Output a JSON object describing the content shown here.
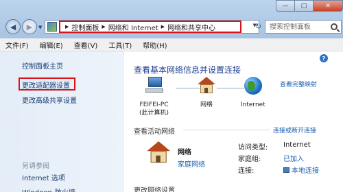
{
  "window": {
    "controls": {
      "minimize": "—",
      "maximize": "□",
      "close": "✕"
    }
  },
  "nav": {
    "back_glyph": "◀",
    "forward_glyph": "▶",
    "history_glyph": "▼",
    "refresh_glyph": "↻"
  },
  "address": {
    "breadcrumbs": [
      "控制面板",
      "网络和 Internet",
      "网络和共享中心"
    ],
    "separator": "▶",
    "dropdown_glyph": "▼"
  },
  "search": {
    "placeholder": "搜索控制面板"
  },
  "menu": [
    "文件(F)",
    "编辑(E)",
    "查看(V)",
    "工具(T)",
    "帮助(H)"
  ],
  "sidebar": {
    "home": "控制面板主页",
    "adapter_settings": "更改适配器设置",
    "advanced_sharing": "更改高级共享设置",
    "see_also": "另请参阅",
    "internet_options": "Internet 选项",
    "firewall": "Windows 防火墙"
  },
  "main": {
    "help": "?",
    "title": "查看基本网络信息并设置连接",
    "see_full_map": "查看完整映射",
    "nodes": [
      {
        "label_line1": "FEIFEI-PC",
        "label_line2": "(此计算机)"
      },
      {
        "label_line1": "网络",
        "label_line2": ""
      },
      {
        "label_line1": "Internet",
        "label_line2": ""
      }
    ],
    "active_networks_title": "查看活动网络",
    "connect_disconnect": "连接或断开连接",
    "active_network": {
      "name": "网络",
      "type": "家庭网络",
      "access_type_label": "访问类型:",
      "access_type_value": "Internet",
      "homegroup_label": "家庭组:",
      "homegroup_value": "已加入",
      "connections_label": "连接:",
      "connections_value": "本地连接"
    },
    "change_settings_title": "更改网络设置"
  }
}
